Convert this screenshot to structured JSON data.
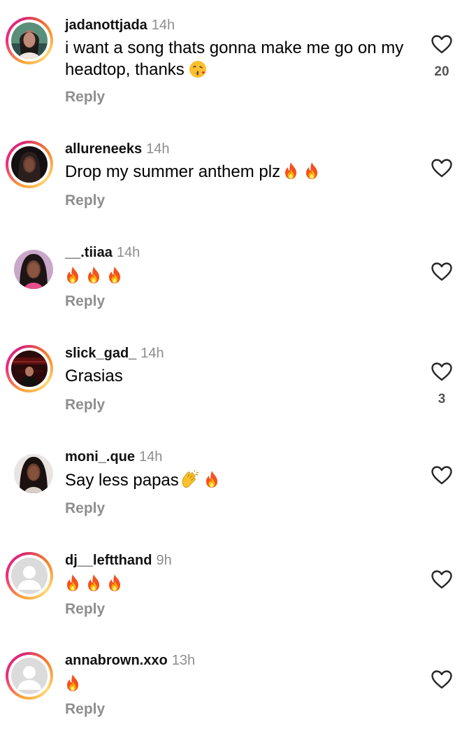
{
  "reply_label": "Reply",
  "colors": {
    "ring_start": "#f9a13a",
    "ring_end": "#ee2a7b",
    "secondary_text": "#8e8e8e"
  },
  "comments": [
    {
      "username": "jadanottjada",
      "time": "14h",
      "text": "i want a song thats gonna make me go on my headtop, thanks",
      "emoji_suffix": "kissing-face-emoji",
      "likes": "20",
      "avatar": "photo-girl-1",
      "story_ring": true
    },
    {
      "username": "allureneeks",
      "time": "14h",
      "text": "Drop my summer anthem plz",
      "emoji_suffix": "fire x2",
      "likes": "",
      "avatar": "photo-girl-2",
      "story_ring": true
    },
    {
      "username": "__.tiiaa",
      "time": "14h",
      "text": "",
      "emoji_suffix": "fire x3",
      "likes": "",
      "avatar": "photo-girl-3",
      "story_ring": false
    },
    {
      "username": "slick_gad_",
      "time": "14h",
      "text": "Grasias",
      "emoji_suffix": "",
      "likes": "3",
      "avatar": "lucifer-poster",
      "story_ring": true
    },
    {
      "username": "moni_.que",
      "time": "14h",
      "text": "Say less papas",
      "emoji_suffix": "clap, fire",
      "likes": "",
      "avatar": "photo-girl-4",
      "story_ring": false
    },
    {
      "username": "dj__leftthand",
      "time": "9h",
      "text": "",
      "emoji_suffix": "fire x3",
      "likes": "",
      "avatar": "default-avatar",
      "story_ring": true
    },
    {
      "username": "annabrown.xxo",
      "time": "13h",
      "text": "",
      "emoji_suffix": "fire x1",
      "likes": "",
      "avatar": "default-avatar",
      "story_ring": true
    }
  ]
}
